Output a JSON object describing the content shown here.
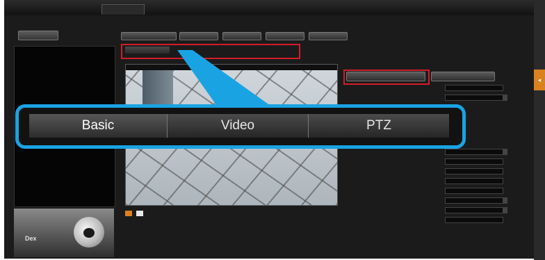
{
  "window": {
    "top_tabs": [
      {
        "label": ""
      },
      {
        "label": ""
      },
      {
        "label": ""
      },
      {
        "label": ""
      },
      {
        "label": ""
      },
      {
        "label": ""
      },
      {
        "label": ""
      },
      {
        "label": ""
      }
    ]
  },
  "sidebar": {
    "button_label": "",
    "tree": {
      "header": "",
      "items": [
        {
          "label": ""
        },
        {
          "label": ""
        }
      ]
    },
    "camera_logo": "Dex"
  },
  "toolbar": {
    "buttons": [
      {
        "label": ""
      },
      {
        "label": ""
      },
      {
        "label": ""
      },
      {
        "label": ""
      },
      {
        "label": ""
      }
    ]
  },
  "small_tabs": [
    {
      "label": ""
    },
    {
      "label": ""
    },
    {
      "label": ""
    }
  ],
  "video": {
    "title": ""
  },
  "big_tabs": [
    {
      "label": "Basic"
    },
    {
      "label": "Video"
    },
    {
      "label": "PTZ"
    }
  ],
  "settings_panel": {
    "title": "",
    "buttons": [
      {
        "label": ""
      },
      {
        "label": ""
      }
    ],
    "rows": [
      {
        "label": "",
        "value": ""
      },
      {
        "label": "",
        "value": ""
      },
      {
        "label": "",
        "value": ""
      },
      {
        "label": "",
        "value": ""
      },
      {
        "label": "",
        "value": ""
      },
      {
        "label": "",
        "value": ""
      },
      {
        "label": "",
        "value": ""
      },
      {
        "label": "",
        "value": ""
      },
      {
        "label": "",
        "value": ""
      },
      {
        "label": "",
        "value": ""
      }
    ],
    "section_heading": "",
    "info_rows": [
      {
        "label": "",
        "value": ""
      },
      {
        "label": "",
        "value": ""
      }
    ]
  },
  "colors": {
    "highlight_red": "#d21d2a",
    "callout_blue": "#1aa3e3",
    "accent_orange": "#d9821e",
    "background": "#1b1b1b"
  }
}
